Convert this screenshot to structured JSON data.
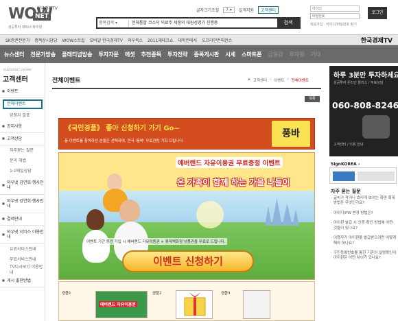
{
  "header": {
    "logo_main": "WOW",
    "logo_net": "NET",
    "logo_tv": "한국경제TV",
    "logo_tagline": "성공투자 파트너 와우넷",
    "top_links": [
      "글자크기조절",
      "7",
      "일격지원"
    ],
    "font_select": "7",
    "customer_center_link": "고객센터",
    "login": {
      "id_placeholder": "아이디",
      "pw_placeholder": "비밀번호",
      "button": "로그인",
      "links": "회원가입 · 아이디/비밀번호 찾기"
    },
    "search": {
      "scope": "종목검색 ▾",
      "text": "전체통합 코스닥 의료주 세종의 대원성명가 진행중",
      "button": "검색"
    }
  },
  "partner_bar": {
    "items": [
      "SK증권전문가",
      "종목상시담당",
      "WOW스트립",
      "모바일 한국경제TV",
      "와우북스",
      "",
      "",
      "2011재테크쇼",
      "대학컨테서",
      "오프라인컨퍼런스"
    ],
    "brand": "한국경제TV"
  },
  "main_nav": {
    "items": [
      "뉴스센터",
      "전문가방송",
      "플래티넘방송",
      "투자자문",
      "에셋",
      "추천종목",
      "투자전략",
      "종목게시판",
      "시세",
      "스마트폰"
    ],
    "ghost_items": [
      "금융감",
      "투자원",
      "기타"
    ]
  },
  "sidebar": {
    "small_label": "customer center",
    "title": "고객센터",
    "items": [
      {
        "label": "이벤트",
        "type": "bullet"
      },
      {
        "label": "전체이벤트",
        "type": "active"
      },
      {
        "label": "당첨자 발표",
        "type": "sub"
      },
      {
        "label": "공지사항",
        "type": "bullet"
      },
      {
        "label": "고객상담",
        "type": "bullet"
      },
      {
        "label": "자주묻는 질문",
        "type": "sub"
      },
      {
        "label": "문의 해법",
        "type": "sub"
      },
      {
        "label": "1:1메일상담",
        "type": "sub"
      },
      {
        "label": "와우넷 감연회·행사안내",
        "type": "bullet-tall"
      },
      {
        "label": "와우넷 강연회·행사안내",
        "type": "bullet-tall"
      },
      {
        "label": "결제안내",
        "type": "bullet"
      },
      {
        "label": "와우넷 서비스 이용안내",
        "type": "bullet-tall"
      },
      {
        "label": "유료서비스안내",
        "type": "sub"
      },
      {
        "label": "무료서비스안내",
        "type": "sub"
      },
      {
        "label": "TV다시보기 이용안내",
        "type": "sub-tall"
      },
      {
        "label": "게시 출판방법",
        "type": "bullet"
      }
    ]
  },
  "content": {
    "title": "전체이벤트",
    "breadcrumb": [
      "▸",
      "고객센터",
      "이벤트",
      "전체이벤트"
    ],
    "list_button": "목록"
  },
  "banner": {
    "headline": "《국민경품》 좋아 신청하기 가기 Go~",
    "subtext": "풍 이벤트를 참여하신 분들은 선택하여, 연극 '풍바' 무료관람 기회 드립니다.",
    "brand": "풍바"
  },
  "poster": {
    "title_line": "에버랜드 자유이용권 무료증정 이벤트",
    "slogan": "온 가족이 함께 하는 가을 나들이",
    "notice": "이벤트 기간 동안 가입 시 에버랜드 자유이용권 + 롯데백화점 상품권을 무료로 드립니다.",
    "apply_button": "이벤트 신청하기"
  },
  "prizes": {
    "labels": [
      "경품1",
      "경품2",
      "경품3"
    ],
    "prize1_text": "에버랜드 자유이용권"
  },
  "right": {
    "ad": {
      "headline": "하루 3분만 투자하세요",
      "sub": "성공투자 온라인 플러스 / 무료상담",
      "phone": "060-808-8246",
      "foot": "고객센터 / 이용 안내"
    },
    "partner_logo": "SignKOREA ›",
    "faq_title": "자주 묻는 질문",
    "faq": [
      "글씨가 작거나 흐리게 보이는 화면 확대 방법은 무엇인가요?",
      "아이디/PW 변경 방법은?",
      "아이핀 발급 시 인증 확인 방법에 어떤 것들이 있나요?",
      "이용자가 아이핀을 발급받으려면 어떻게 해야 하나요?",
      "구민등록번호를 통한 기존의 실명확인이 아이핀은 어떤 차이가 있나요?"
    ]
  }
}
